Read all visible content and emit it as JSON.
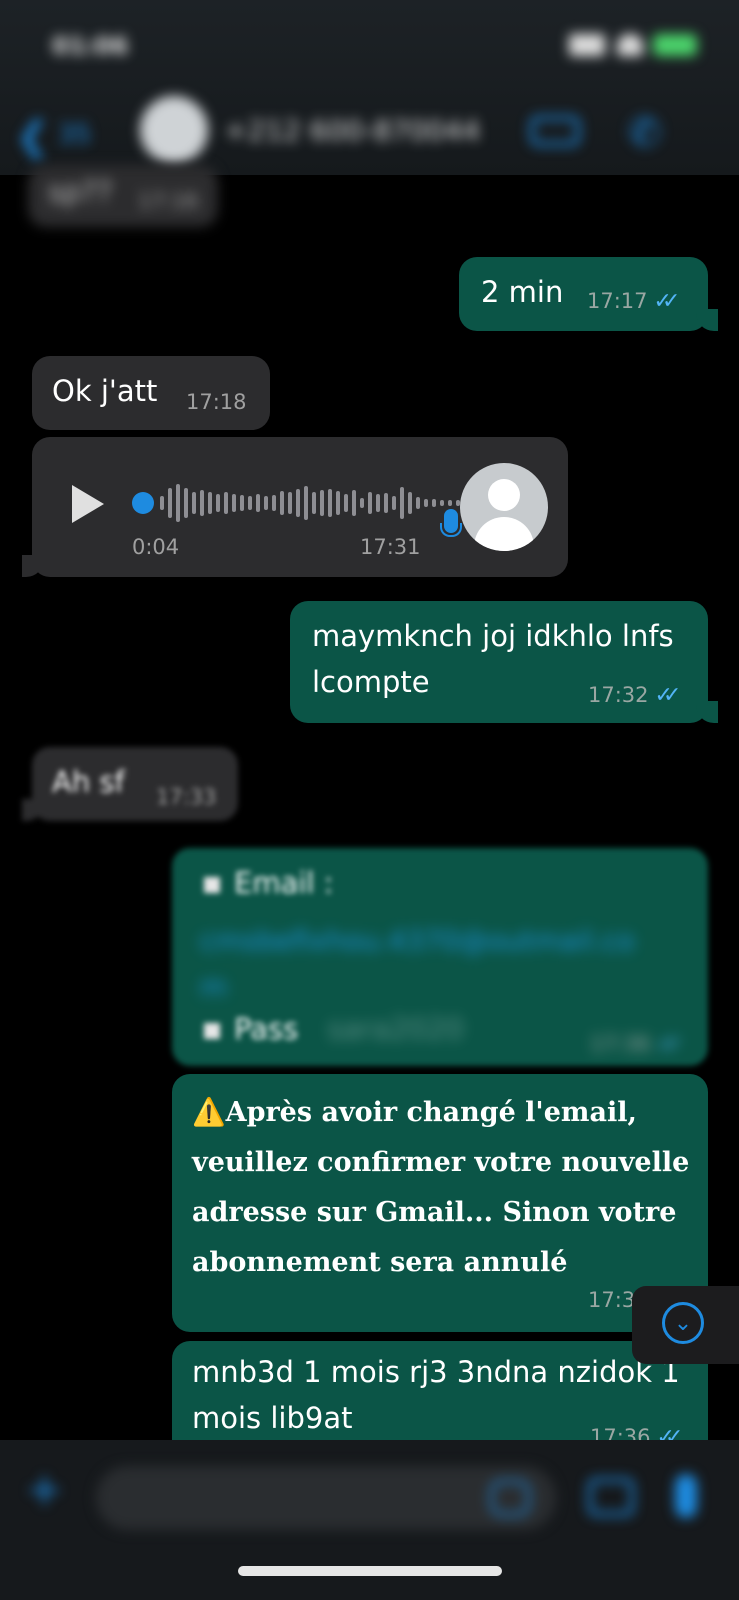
{
  "status_bar": {
    "time": "01:06"
  },
  "header": {
    "unread_count": "35",
    "contact_name": "+212 600-870044"
  },
  "messages": {
    "partial_top": {
      "text": "sp??",
      "time": "17:16"
    },
    "m1": {
      "text": "2 min",
      "time": "17:17",
      "ticks": "✓✓"
    },
    "m2": {
      "text": "Ok j'att",
      "time": "17:18"
    },
    "voice": {
      "duration": "0:04",
      "time": "17:31"
    },
    "m3": {
      "line1": "maymknch joj idkhlo lnfs",
      "line2": "lcompte",
      "time": "17:32",
      "ticks": "✓✓"
    },
    "m4": {
      "text": "Ah sf",
      "time": "17:33"
    },
    "m5": {
      "email_label": "Email :",
      "email_value": "cmsbefixhou.4370@outmail.co m",
      "pass_label": "Pass",
      "pass_value": "sara2020",
      "time": "17:36",
      "ticks": "✓✓"
    },
    "m6": {
      "line1": "⚠️Après avoir changé l'email,",
      "line2": "veuillez confirmer votre nouvelle",
      "line3": "adresse sur Gmail... Sinon votre",
      "line4": "abonnement sera annulé",
      "time": "17:3"
    },
    "m7": {
      "line1": "mnb3d 1 mois rj3 3ndna nzidok 1",
      "line2": "mois lib9at",
      "time": "17:36",
      "ticks": "✓✓"
    }
  },
  "icons": {
    "back": "chevron-left-icon",
    "video": "video-camera-icon",
    "phone": "phone-icon",
    "play": "play-icon",
    "mic": "microphone-icon",
    "scroll": "chevron-down-icon",
    "plus": "plus-icon",
    "sticker": "sticker-icon",
    "camera": "camera-icon"
  },
  "colors": {
    "background": "#000000",
    "incoming_bubble": "#2c2c2e",
    "outgoing_bubble": "#0b5547",
    "accent": "#1e8be0",
    "read_ticks": "#53b4f6"
  }
}
